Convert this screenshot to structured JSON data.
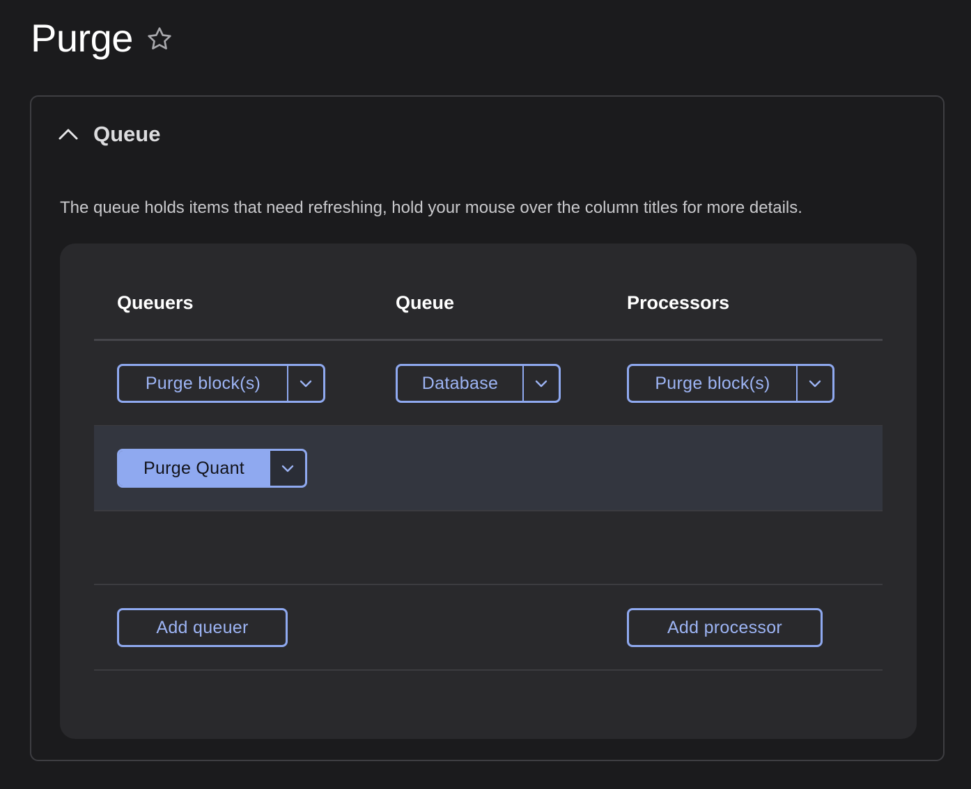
{
  "page": {
    "title": "Purge"
  },
  "queue_section": {
    "summary_title": "Queue",
    "description": "The queue holds items that need refreshing, hold your mouse over the column titles for more details.",
    "columns": {
      "queuers": "Queuers",
      "queue": "Queue",
      "processors": "Processors"
    },
    "queuers": [
      {
        "label": "Purge block(s)",
        "active": false
      },
      {
        "label": "Purge Quant",
        "active": true
      }
    ],
    "queue_backend": {
      "label": "Database"
    },
    "processors": [
      {
        "label": "Purge block(s)"
      }
    ],
    "add_queuer_label": "Add queuer",
    "add_processor_label": "Add processor"
  },
  "colors": {
    "accent": "#8fa9f0",
    "background": "#1b1b1d",
    "card": "#29292c",
    "highlight_row": "#33363f"
  }
}
